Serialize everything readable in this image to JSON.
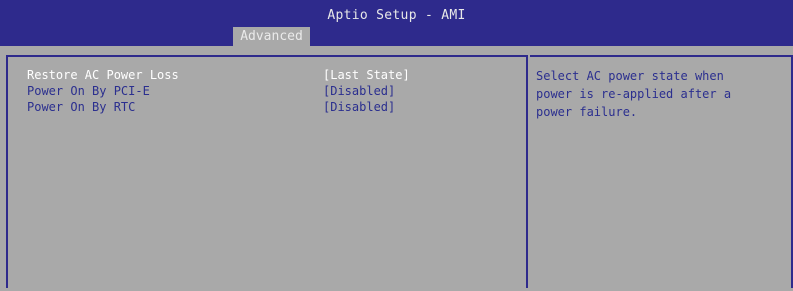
{
  "window": {
    "title": "Aptio Setup - AMI"
  },
  "tabs": [
    {
      "label": "Advanced",
      "active": true
    }
  ],
  "settings": [
    {
      "label": "Restore AC Power Loss",
      "value": "[Last State]",
      "selected": true
    },
    {
      "label": "Power On By PCI-E",
      "value": "[Disabled]",
      "selected": false
    },
    {
      "label": "Power On By RTC",
      "value": "[Disabled]",
      "selected": false
    }
  ],
  "help": {
    "lines": [
      "Select AC power state when",
      "power is re-applied after a",
      "power failure."
    ]
  },
  "colors": {
    "header_bg": "#2e2a8c",
    "panel_bg": "#a9a9a9",
    "selected_text": "#ffffff",
    "normal_text": "#2b2f8f",
    "border": "#2e2a8c"
  }
}
